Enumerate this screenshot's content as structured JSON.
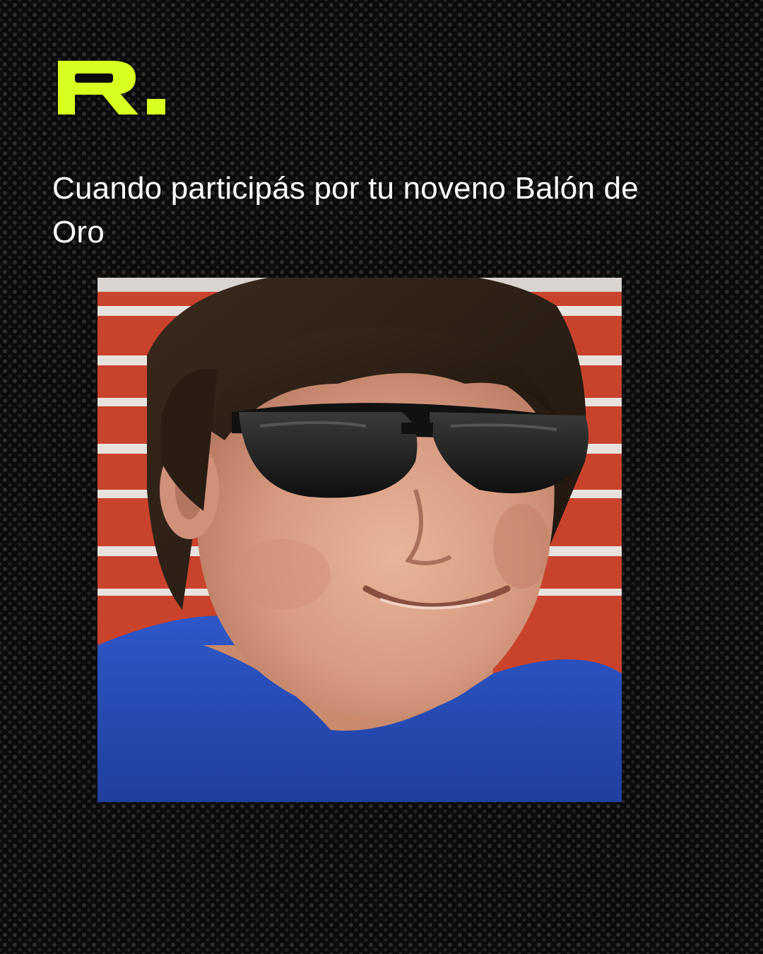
{
  "brand": {
    "logo_text": "R.",
    "accent_color": "#d7ff1f"
  },
  "post": {
    "caption": "Cuando participás por tu noveno Balón de Oro"
  },
  "photo": {
    "subject": "smiling-man-with-dark-sunglasses",
    "backdrop_color": "#c9432c",
    "shirt_color": "#2a4fc0"
  }
}
